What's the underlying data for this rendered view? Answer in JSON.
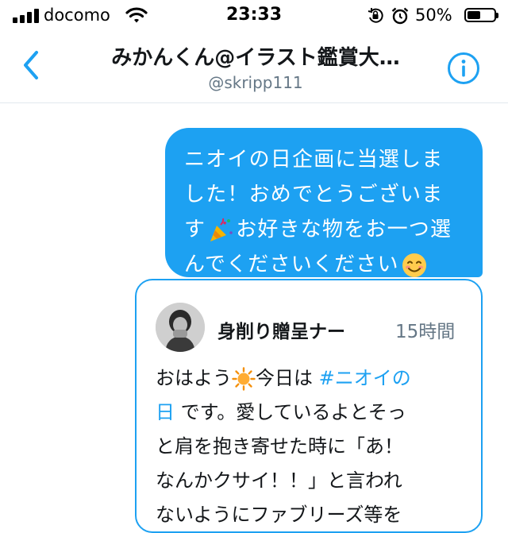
{
  "status_bar": {
    "carrier": "docomo",
    "time": "23:33",
    "battery_percent": "50%",
    "battery_level": 0.5,
    "icons": [
      "signal-icon",
      "wifi-icon",
      "orientation-lock-icon",
      "alarm-icon",
      "battery-icon"
    ]
  },
  "header": {
    "title": "みかんくん@イラスト鑑賞大…",
    "handle": "@skripp111",
    "back_icon": "chevron-left-icon",
    "info_icon": "info-icon"
  },
  "message": {
    "lines": [
      "ニオイの日企画に当選しま",
      "した！おめでとうございま",
      "す",
      "お好きな物をお一つ選",
      "んでくださいください"
    ],
    "emojis": [
      "party-popper-icon",
      "smiling-face-icon"
    ]
  },
  "quoted_tweet": {
    "author": "身削り贈呈ナー",
    "time": "15時間",
    "text": {
      "l1_a": "おはよう",
      "l1_b": "今日は ",
      "l1_tag": "#ニオイの",
      "l2_tag": "日",
      "l2_b": " です。愛しているよとそっ",
      "l3": "と肩を抱き寄せた時に「あ！",
      "l4": "なんかクサイ！！」と言われ",
      "l5": "ないようにファブリーズ等を"
    },
    "emojis": [
      "sun-icon"
    ],
    "colors": {
      "accent": "#1da1f2"
    }
  }
}
